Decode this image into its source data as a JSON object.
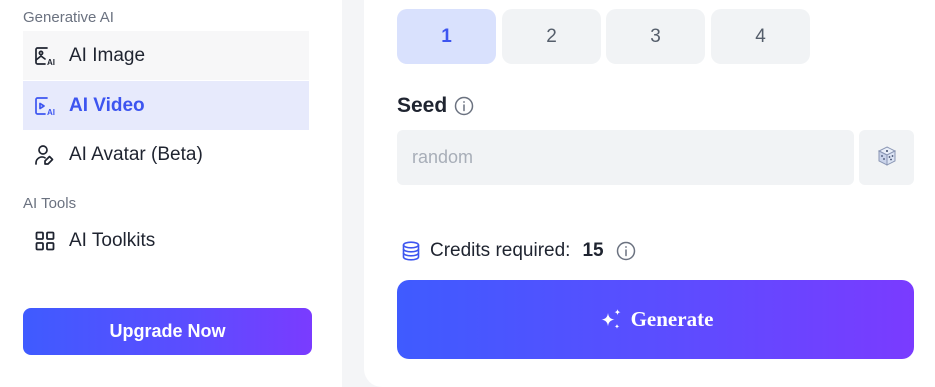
{
  "sidebar": {
    "section_generative": "Generative AI",
    "items_generative": [
      {
        "label": "AI Image",
        "icon": "image-ai-icon",
        "state": "hovered"
      },
      {
        "label": "AI Video",
        "icon": "video-ai-icon",
        "state": "active"
      },
      {
        "label": "AI Avatar (Beta)",
        "icon": "user-edit-icon",
        "state": "normal"
      }
    ],
    "section_tools": "AI Tools",
    "items_tools": [
      {
        "label": "AI Toolkits",
        "icon": "grid-icon"
      }
    ],
    "upgrade_label": "Upgrade Now"
  },
  "count_options": {
    "options": [
      "1",
      "2",
      "3",
      "4"
    ],
    "selected": "1"
  },
  "seed": {
    "label": "Seed",
    "placeholder": "random",
    "value": ""
  },
  "credits": {
    "label": "Credits required:",
    "value": "15"
  },
  "generate_label": "Generate",
  "colors": {
    "accent": "#3d55f0",
    "gradient_start": "#3f5bff",
    "gradient_end": "#7a3bff",
    "active_bg": "#e7eafc"
  }
}
